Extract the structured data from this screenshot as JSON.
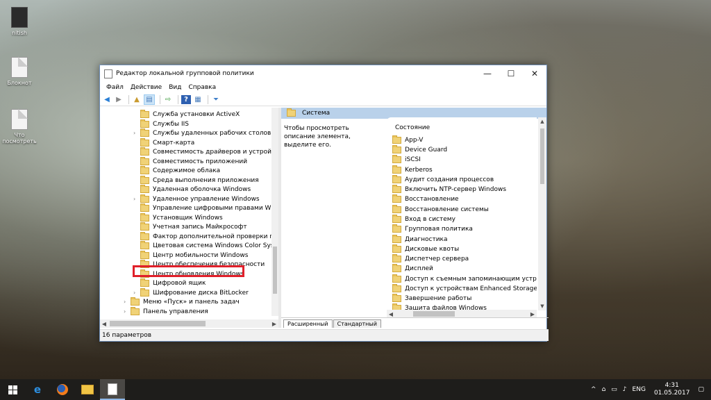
{
  "desktop": {
    "icons": [
      {
        "label": "nitish"
      },
      {
        "label": "Блокнот"
      },
      {
        "label": "Что\nпосмотреть"
      }
    ]
  },
  "window": {
    "title": "Редактор локальной групповой политики",
    "controls": {
      "minimize": "—",
      "maximize": "☐",
      "close": "✕"
    },
    "menu": [
      "Файл",
      "Действие",
      "Вид",
      "Справка"
    ],
    "tree": [
      {
        "label": "Служба установки ActiveX",
        "expandable": false
      },
      {
        "label": "Службы IIS",
        "expandable": false
      },
      {
        "label": "Службы удаленных рабочих столов",
        "expandable": true
      },
      {
        "label": "Смарт-карта",
        "expandable": false
      },
      {
        "label": "Совместимость драйверов и устройств",
        "expandable": false
      },
      {
        "label": "Совместимость приложений",
        "expandable": false
      },
      {
        "label": "Содержимое облака",
        "expandable": false
      },
      {
        "label": "Среда выполнения приложения",
        "expandable": false
      },
      {
        "label": "Удаленная оболочка Windows",
        "expandable": false
      },
      {
        "label": "Удаленное управление Windows",
        "expandable": true
      },
      {
        "label": "Управление цифровыми правами Windo",
        "expandable": false
      },
      {
        "label": "Установщик Windows",
        "expandable": false
      },
      {
        "label": "Учетная запись Майкрософт",
        "expandable": false
      },
      {
        "label": "Фактор дополнительной проверки подлі",
        "expandable": false
      },
      {
        "label": "Цветовая система Windows Color System",
        "expandable": false
      },
      {
        "label": "Центр мобильности Windows",
        "expandable": false
      },
      {
        "label": "Центр обеспечения безопасности",
        "expandable": false
      },
      {
        "label": "Центр обновления Windows",
        "expandable": false,
        "selected": true
      },
      {
        "label": "Цифровой ящик",
        "expandable": false
      },
      {
        "label": "Шифрование диска BitLocker",
        "expandable": true
      },
      {
        "label": "Меню «Пуск» и панель задач",
        "expandable": true,
        "level": 0
      },
      {
        "label": "Панель управления",
        "expandable": true,
        "level": 0
      }
    ],
    "right": {
      "header": "Система",
      "description": "Чтобы просмотреть описание элемента, выделите его.",
      "column": "Состояние",
      "items": [
        "App-V",
        "Device Guard",
        "iSCSI",
        "Kerberos",
        "Аудит создания процессов",
        "Включить NTP-сервер Windows",
        "Восстановление",
        "Восстановление системы",
        "Вход в систему",
        "Групповая политика",
        "Диагностика",
        "Дисковые квоты",
        "Диспетчер сервера",
        "Дисплей",
        "Доступ к съемным запоминающим устройства",
        "Доступ к устройствам Enhanced Storage",
        "Завершение работы",
        "Защита файлов Windows"
      ],
      "tabs": [
        "Расширенный",
        "Стандартный"
      ]
    },
    "status": "16 параметров"
  },
  "taskbar": {
    "lang": "ENG",
    "time": "4:31",
    "date": "01.05.2017",
    "colors": {
      "taskbar": "#1e1d1b",
      "highlight": "#e0202a",
      "header": "#b9d1ea"
    }
  }
}
